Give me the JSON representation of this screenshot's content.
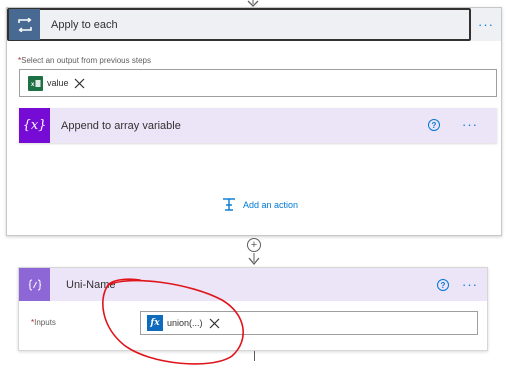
{
  "foreach": {
    "title": "Apply to each",
    "more": "···",
    "select_label_req": "*",
    "select_label": "Select an output from previous steps",
    "token_label": "value"
  },
  "append": {
    "title": "Append to array variable",
    "icon_text": "{x}",
    "help": "?",
    "more": "···"
  },
  "add_action": "Add an action",
  "connector_plus": "+",
  "uni": {
    "title": "Uni-Name",
    "help": "?",
    "more": "···",
    "inputs_req": "*",
    "inputs_label": "Inputs",
    "token_label": "union(...)",
    "fx": "fx"
  },
  "colors": {
    "foreach_icon": "#486991",
    "variable_icon": "#770bd6",
    "compose_icon": "#8e67d6",
    "accent": "#0078d4",
    "excel_green": "#1e7145",
    "annotation_red": "#e0151b"
  }
}
